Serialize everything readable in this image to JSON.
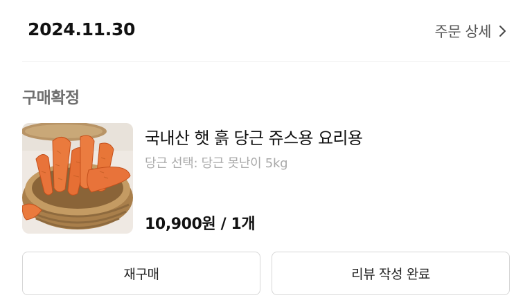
{
  "order": {
    "date": "2024.11.30",
    "detail_link_label": "주문 상세"
  },
  "status_label": "구매확정",
  "product": {
    "name": "국내산 햇 흙 당근 쥬스용 요리용",
    "option": "당근 선택: 당근 못난이 5kg",
    "price": "10,900원 / 1개",
    "image": "carrots-in-basket-photo"
  },
  "actions": {
    "rebuy_label": "재구매",
    "review_label": "리뷰 작성 완료"
  },
  "icons": {
    "detail_chevron": "chevron-right-icon"
  }
}
